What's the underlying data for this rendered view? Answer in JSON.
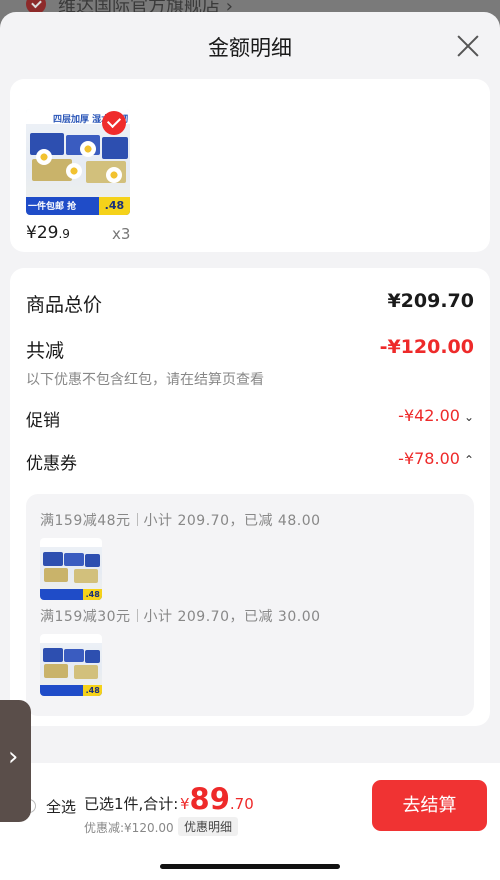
{
  "background": {
    "shop_name": "维达国际官方旗舰店 ›"
  },
  "sheet": {
    "title": "金额明细"
  },
  "product": {
    "banner_text": "四层加厚 湿水柔韧",
    "promo_tag": "一件包邮 抢",
    "promo_price": ".48",
    "price_int": "¥29",
    "price_dec": ".9",
    "quantity": "x3"
  },
  "summary": {
    "total_label": "商品总价",
    "total_value": "¥209.70",
    "reduce_label": "共减",
    "reduce_value": "-¥120.00",
    "reduce_hint": "以下优惠不包含红包，请在结算页查看",
    "promo_label": "促销",
    "promo_value": "-¥42.00",
    "coupon_label": "优惠券",
    "coupon_value": "-¥78.00",
    "chevron_down": "⌄",
    "chevron_up": "⌃"
  },
  "coupons": [
    {
      "rule": "满159减48元",
      "detail": "小计 209.70，已减 48.00"
    },
    {
      "rule": "满159减30元",
      "detail": "小计 209.70，已减 30.00"
    }
  ],
  "footer": {
    "select_all": "全选",
    "selected": "已选1件,合计:",
    "currency": "¥",
    "total_int": "89",
    "total_dec": ".70",
    "discount": "优惠减:¥120.00",
    "detail_button": "优惠明细",
    "checkout_button": "去结算",
    "side_arrow": "›"
  },
  "colors": {
    "accent": "#f03333",
    "price_red": "#ee2a2a"
  }
}
